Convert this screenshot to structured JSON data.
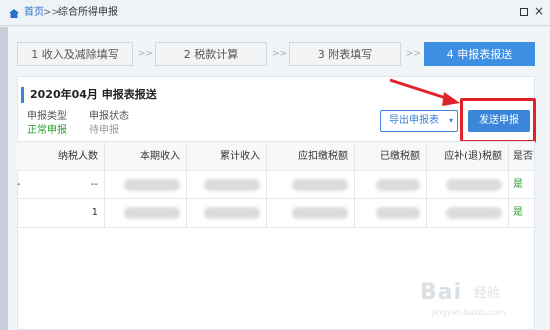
{
  "breadcrumb": {
    "home": "首页",
    "separator": ">>",
    "current": "综合所得申报"
  },
  "window_controls": {
    "close_glyph": "×"
  },
  "steps": [
    {
      "label": "1 收入及减除填写",
      "active": false
    },
    {
      "label": "2 税款计算",
      "active": false
    },
    {
      "label": "3 附表填写",
      "active": false
    },
    {
      "label": "4 申报表报送",
      "active": true
    }
  ],
  "step_separator": ">>",
  "report": {
    "title": "2020年04月  申报表报送",
    "type_label": "申报类型",
    "type_value": "正常申报",
    "status_label": "申报状态",
    "status_value": "待申报"
  },
  "actions": {
    "export_label": "导出申报表",
    "export_caret": "▾",
    "send_label": "发送申报"
  },
  "table": {
    "columns": [
      "纳税人数",
      "本期收入",
      "累计收入",
      "应扣缴税额",
      "已缴税额",
      "应补(退)税额",
      "是否可"
    ],
    "rows": [
      {
        "lead": "-",
        "taxpayers": "--",
        "flag": "是"
      },
      {
        "lead": "",
        "taxpayers": "1",
        "flag": "是"
      }
    ]
  },
  "watermark": {
    "brand": "Bai",
    "sub": "经验",
    "url": "jingyan.baidu.com"
  },
  "colors": {
    "accent": "#3b86d9",
    "active_step": "#3d8fe3",
    "highlight": "#e2222a",
    "ok_green": "#27a02e"
  }
}
